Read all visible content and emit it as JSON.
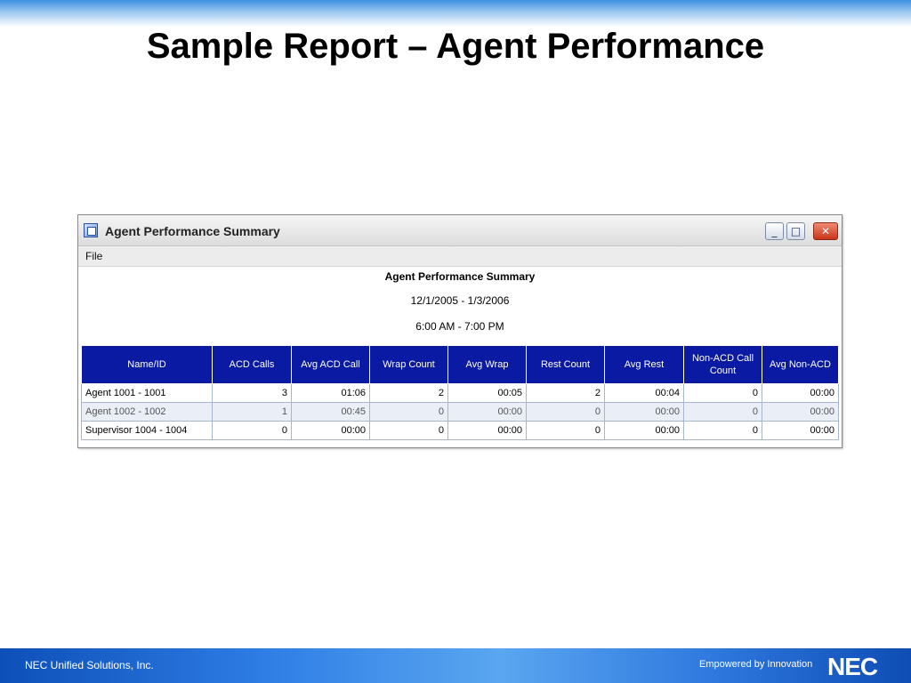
{
  "slide": {
    "title": "Sample Report – Agent Performance",
    "footer_company": "NEC Unified Solutions, Inc.",
    "footer_tagline": "Empowered by Innovation",
    "footer_logo": "NEC"
  },
  "window": {
    "title": "Agent Performance Summary",
    "icon": "report-app-icon",
    "controls": {
      "minimize": "_",
      "maximize": "□",
      "close": "✕"
    },
    "menu": [
      "File"
    ]
  },
  "report": {
    "title": "Agent Performance Summary",
    "date_range": "12/1/2005 - 1/3/2006",
    "time_range": "6:00 AM - 7:00 PM",
    "columns": [
      "Name/ID",
      "ACD Calls",
      "Avg ACD Call",
      "Wrap Count",
      "Avg Wrap",
      "Rest Count",
      "Avg Rest",
      "Non-ACD Call Count",
      "Avg Non-ACD"
    ],
    "rows": [
      [
        "Agent 1001 - 1001",
        "3",
        "01:06",
        "2",
        "00:05",
        "2",
        "00:04",
        "0",
        "00:00"
      ],
      [
        "Agent 1002 - 1002",
        "1",
        "00:45",
        "0",
        "00:00",
        "0",
        "00:00",
        "0",
        "00:00"
      ],
      [
        "Supervisor 1004 - 1004",
        "0",
        "00:00",
        "0",
        "00:00",
        "0",
        "00:00",
        "0",
        "00:00"
      ]
    ]
  },
  "colors": {
    "header_bg": "#0a1aa3",
    "footer_gradient_start": "#0d4fb8",
    "top_bar": "#3d8fe0"
  }
}
